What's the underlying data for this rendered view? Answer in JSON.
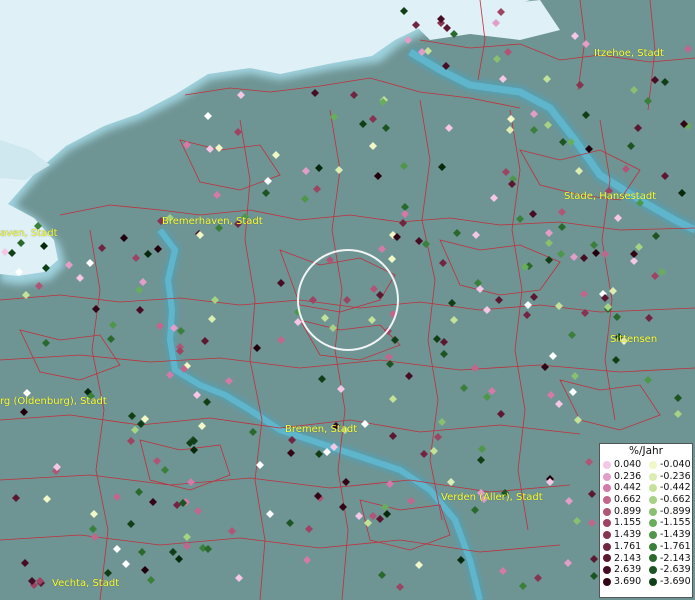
{
  "map": {
    "colors": {
      "land": "#6f9494",
      "sea": "#dff0f6",
      "river": "#4aa6c0",
      "border": "#c0303a",
      "label": "#ffff33"
    },
    "labels": [
      {
        "id": "itzehoe",
        "text": "Itzehoe, Stadt"
      },
      {
        "id": "bremerhaven",
        "text": "Bremerhaven, Stadt"
      },
      {
        "id": "haven",
        "text": "aven, Stadt"
      },
      {
        "id": "stade",
        "text": "Stade, Hansestadt"
      },
      {
        "id": "sittensen",
        "text": "Sittensen"
      },
      {
        "id": "oldenburg",
        "text": "rg (Oldenburg), Stadt"
      },
      {
        "id": "bremen",
        "text": "Bremen, Stadt"
      },
      {
        "id": "verden",
        "text": "Verden (Aller), Stadt"
      },
      {
        "id": "vechta",
        "text": "Vechta, Stadt"
      }
    ]
  },
  "legend": {
    "title": "%/Jahr",
    "positive_colors": [
      "#f6c6e6",
      "#e29ec8",
      "#d37aa8",
      "#c2668c",
      "#b05575",
      "#9c4462",
      "#873451",
      "#712540",
      "#5c1830",
      "#470d22",
      "#330515",
      "#21000b"
    ],
    "negative_colors": [
      "#f1f7c6",
      "#dcedb1",
      "#c3e298",
      "#a6d284",
      "#88c070",
      "#68ad5c",
      "#4d964a",
      "#3a7f3a",
      "#296a2c",
      "#1c5521",
      "#103f16",
      "#06290c"
    ],
    "positive_values": [
      "0.040",
      "0.236",
      "0.442",
      "0.662",
      "0.899",
      "1.155",
      "1.439",
      "1.761",
      "2.143",
      "2.639",
      "3.690"
    ],
    "negative_values": [
      "-0.040",
      "-0.236",
      "-0.442",
      "-0.662",
      "-0.899",
      "-1.155",
      "-1.439",
      "-1.761",
      "-2.143",
      "-2.639",
      "-3.690"
    ],
    "white_color": "#ffffff"
  }
}
